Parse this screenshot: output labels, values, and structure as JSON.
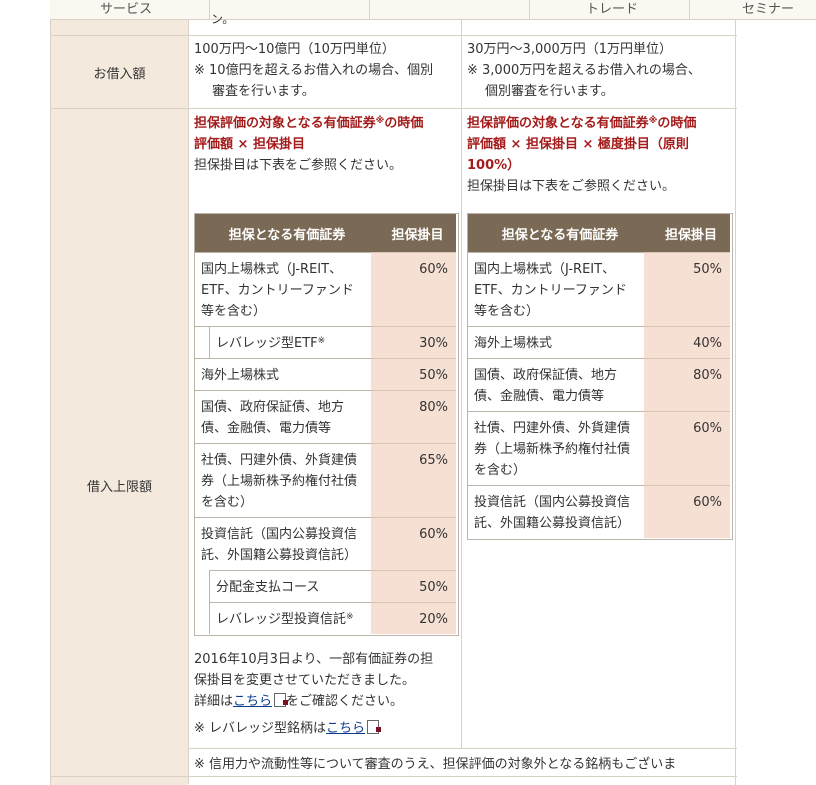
{
  "top_tabs": [
    {
      "label": "サービス"
    },
    {
      "label": ""
    },
    {
      "label": ""
    },
    {
      "label": "トレード"
    },
    {
      "label": "セミナー"
    }
  ],
  "top_partial_text": "ン。",
  "loan_amount": {
    "label": "お借入額",
    "col1": {
      "line1": "100万円～10億円（10万円単位）",
      "note1": "※ 10億円を超えるお借入れの場合、個別",
      "note2": "審査を行います。"
    },
    "col2": {
      "line1": "30万円～3,000万円（1万円単位）",
      "note1": "※ 3,000万円を超えるお借入れの場合、",
      "note2": "個別審査を行います。"
    }
  },
  "loan_limit": {
    "label": "借入上限額",
    "col1": {
      "formula_1a": "担保評価の対象となる有価証券",
      "formula_sup": "※",
      "formula_1b": "の時価",
      "formula_2": "評価額 × 担保掛目",
      "note": "担保掛目は下表をご参照ください。",
      "table": {
        "header_name": "担保となる有価証券",
        "header_rate": "担保掛目",
        "rows": [
          {
            "lines": [
              "国内上場株式（J-REIT、",
              "ETF、カントリーファンド",
              "等を含む）"
            ],
            "rate": "60%"
          },
          {
            "lines": [
              "レバレッジ型ETF"
            ],
            "sup": "※",
            "rate": "30%"
          },
          {
            "lines": [
              "海外上場株式"
            ],
            "rate": "50%"
          },
          {
            "lines": [
              "国債、政府保証債、地方",
              "債、金融債、電力債等"
            ],
            "rate": "80%"
          },
          {
            "lines": [
              "社債、円建外債、外貨建債",
              "券（上場新株予約権付社債",
              "を含む）"
            ],
            "rate": "65%"
          },
          {
            "lines": [
              "投資信託（国内公募投資信",
              "託、外国籍公募投資信託）"
            ],
            "rate": "60%"
          },
          {
            "lines": [
              "分配金支払コース"
            ],
            "rate": "50%"
          },
          {
            "lines": [
              "レバレッジ型投資信託"
            ],
            "sup": "※",
            "rate": "20%"
          }
        ]
      },
      "after1": "2016年10月3日より、一部有価証券の担",
      "after2": "保掛目を変更させていただきました。",
      "after3_pre": "詳細は",
      "after3_link": "こちら",
      "after3_post": "をご確認ください。",
      "after4_pre": "※ レバレッジ型銘柄は",
      "after4_link": "こちら"
    },
    "col2": {
      "formula_1a": "担保評価の対象となる有価証券",
      "formula_sup": "※",
      "formula_1b": "の時価",
      "formula_2": "評価額 × 担保掛目 × 極度掛目（原則",
      "formula_3": "100%）",
      "note": "担保掛目は下表をご参照ください。",
      "table": {
        "header_name": "担保となる有価証券",
        "header_rate": "担保掛目",
        "rows": [
          {
            "lines": [
              "国内上場株式（J-REIT、",
              "ETF、カントリーファンド",
              "等を含む）"
            ],
            "rate": "50%"
          },
          {
            "lines": [
              "海外上場株式"
            ],
            "rate": "40%"
          },
          {
            "lines": [
              "国債、政府保証債、地方",
              "債、金融債、電力債等"
            ],
            "rate": "80%"
          },
          {
            "lines": [
              "社債、円建外債、外貨建債",
              "券（上場新株予約権付社債",
              "を含む）"
            ],
            "rate": "60%"
          },
          {
            "lines": [
              "投資信託（国内公募投資信",
              "託、外国籍公募投資信託）"
            ],
            "rate": "60%"
          }
        ]
      }
    }
  },
  "bottom_note": "※ 信用力や流動性等について審査のうえ、担保評価の対象外となる銘柄もございま"
}
